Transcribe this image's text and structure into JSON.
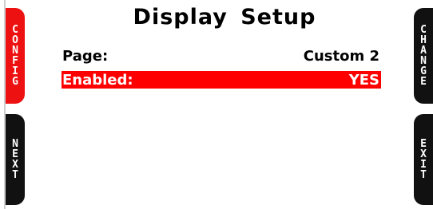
{
  "title": "Display Setup",
  "softkeys": {
    "config": "CONFIG",
    "next": "NEXT",
    "change": "CHANGE",
    "exit": "EXIT"
  },
  "rows": [
    {
      "label": "Page:",
      "value": "Custom 2",
      "selected": false
    },
    {
      "label": "Enabled:",
      "value": "YES",
      "selected": true
    }
  ],
  "colors": {
    "accent": "#ff0000",
    "key_dark": "#111111",
    "background": "#ffffff"
  }
}
